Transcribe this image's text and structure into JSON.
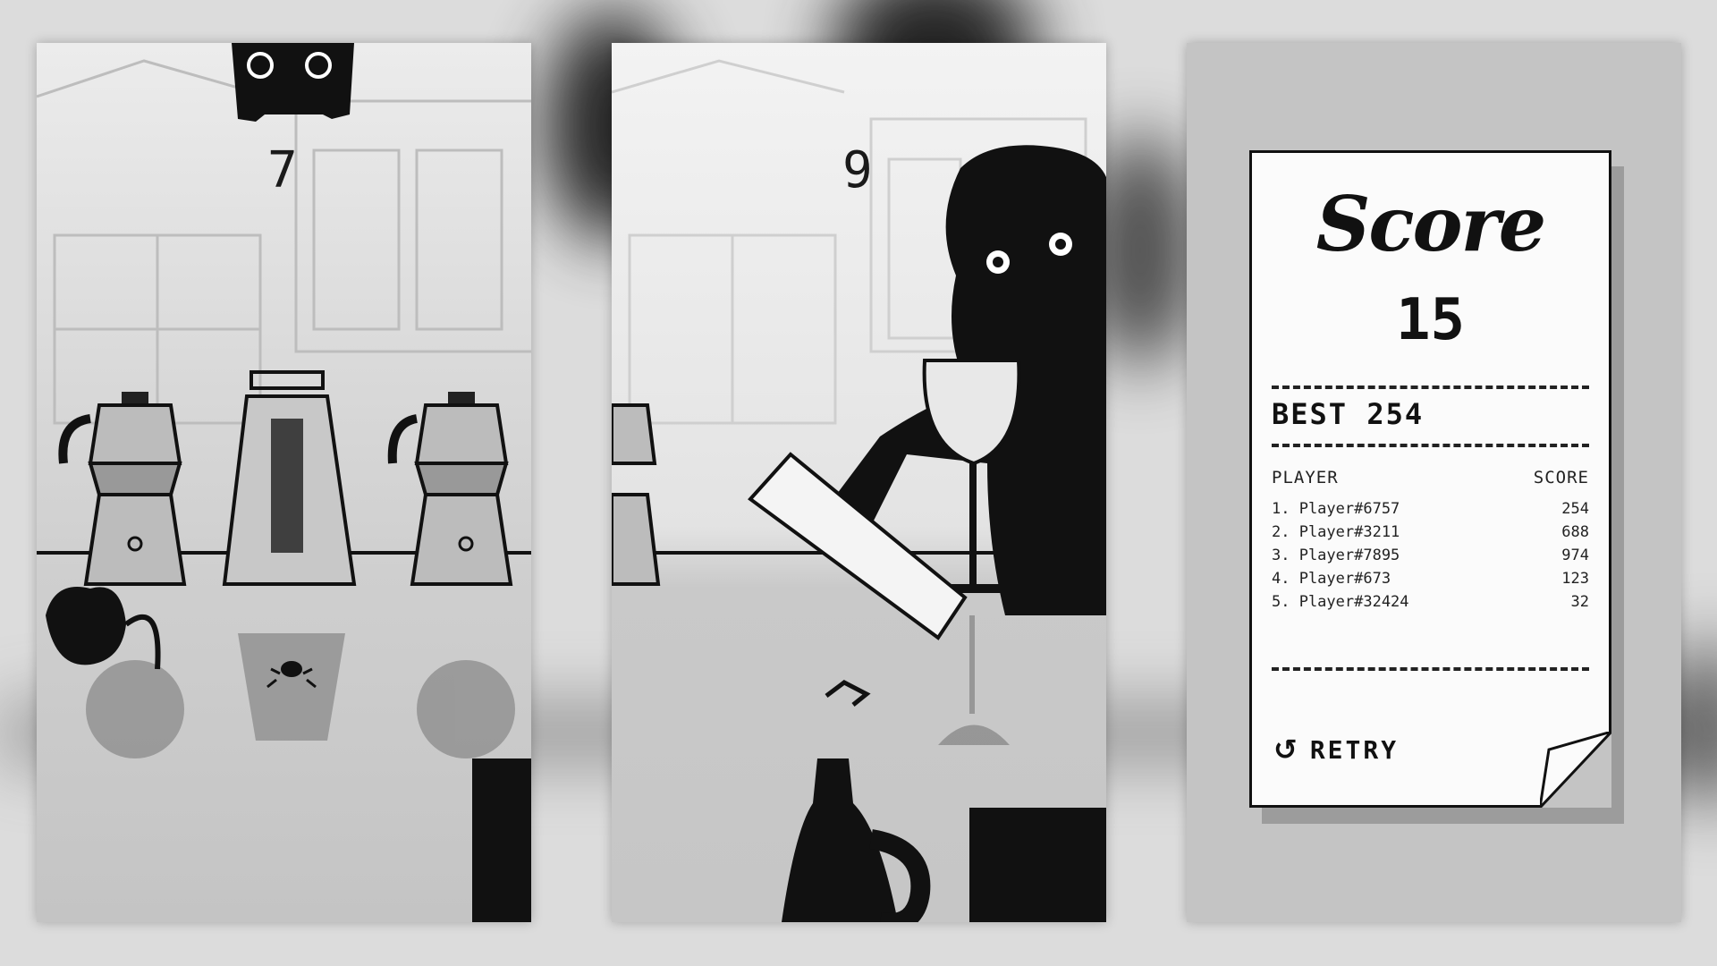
{
  "game": {
    "panel_left": {
      "counter": "7"
    },
    "panel_middle": {
      "counter": "9"
    },
    "score_screen": {
      "title": "Score",
      "score": "15",
      "best": "BEST 254",
      "columns": {
        "player": "PLAYER",
        "score": "SCORE"
      },
      "leaderboard": [
        {
          "rank_name": "1. Player#6757",
          "score": "254"
        },
        {
          "rank_name": "2. Player#3211",
          "score": "688"
        },
        {
          "rank_name": "3. Player#7895",
          "score": "974"
        },
        {
          "rank_name": "4. Player#673",
          "score": "123"
        },
        {
          "rank_name": "5. Player#32424",
          "score": "32"
        }
      ],
      "retry_label": "RETRY",
      "retry_icon": "retry-arrow-icon"
    }
  },
  "colors": {
    "ink": "#111111",
    "paper": "#fbfbfb",
    "panel_gray": "#c4c4c4"
  }
}
